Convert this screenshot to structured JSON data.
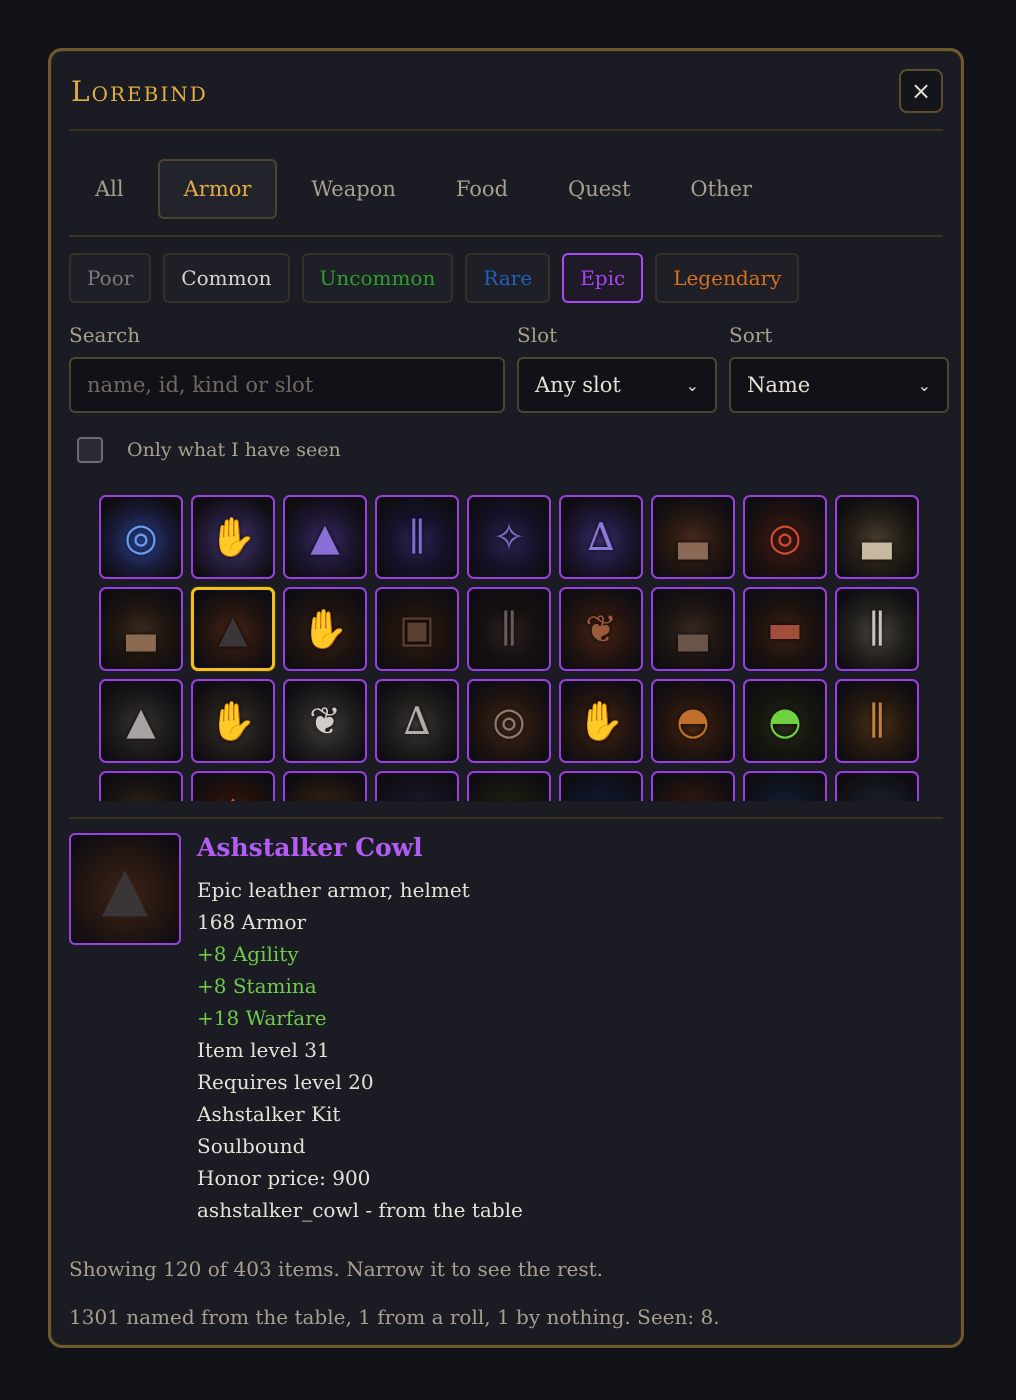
{
  "app": {
    "title": "Lorebind",
    "close_glyph": "×"
  },
  "tabs": [
    "All",
    "Armor",
    "Weapon",
    "Food",
    "Quest",
    "Other"
  ],
  "active_tab": "Armor",
  "rarities": [
    {
      "label": "Poor",
      "color": "#7b7b7b",
      "active": false
    },
    {
      "label": "Common",
      "color": "#d8d4cc",
      "active": false
    },
    {
      "label": "Uncommon",
      "color": "#2ca02c",
      "active": false
    },
    {
      "label": "Rare",
      "color": "#2060c0",
      "active": false
    },
    {
      "label": "Epic",
      "color": "#a845f0",
      "active": true
    },
    {
      "label": "Legendary",
      "color": "#d8701c",
      "active": false
    }
  ],
  "filters": {
    "search_label": "Search",
    "search_placeholder": "name, id, kind or slot",
    "slot_label": "Slot",
    "slot_value": "Any slot",
    "sort_label": "Sort",
    "sort_value": "Name",
    "seen_checkbox_label": "Only what I have seen",
    "seen_checked": false
  },
  "grid": {
    "selected_index": 10,
    "items": [
      {
        "icon": "ring-icon",
        "c1": "#2b4f9c",
        "c2": "#1a1c3d",
        "gc": "#6b9af2"
      },
      {
        "icon": "gauntlets-icon",
        "c1": "#4d3d7c",
        "c2": "#221c38",
        "gc": "#9d8ee0"
      },
      {
        "icon": "hood-icon",
        "c1": "#3a2c6a",
        "c2": "#1c1530",
        "gc": "#8a70d6"
      },
      {
        "icon": "leggings-icon",
        "c1": "#2a2556",
        "c2": "#14122a",
        "gc": "#7b6cd0"
      },
      {
        "icon": "wings-icon",
        "c1": "#2a2350",
        "c2": "#15122a",
        "gc": "#7d6cc8"
      },
      {
        "icon": "robe-icon",
        "c1": "#3b2f6e",
        "c2": "#1c1634",
        "gc": "#8b78d8"
      },
      {
        "icon": "boots-icon",
        "c1": "#4a2a1c",
        "c2": "#231611",
        "gc": "#8a6a56"
      },
      {
        "icon": "ring-icon",
        "c1": "#4a1f18",
        "c2": "#221210",
        "gc": "#d04a30"
      },
      {
        "icon": "boots-icon",
        "c1": "#4a3e30",
        "c2": "#231d16",
        "gc": "#c8b8a0"
      },
      {
        "icon": "boots-icon",
        "c1": "#3e2a1e",
        "c2": "#1d1510",
        "gc": "#8a6a50"
      },
      {
        "icon": "hood-icon",
        "c1": "#4a2616",
        "c2": "#231410",
        "gc": "#3a3638"
      },
      {
        "icon": "gauntlets-icon",
        "c1": "#3e2418",
        "c2": "#1e1410",
        "gc": "#9a8070"
      },
      {
        "icon": "chest-armor-icon",
        "c1": "#3a2216",
        "c2": "#1c120e",
        "gc": "#5a4030"
      },
      {
        "icon": "leggings-icon",
        "c1": "#2c2220",
        "c2": "#151010",
        "gc": "#6a5a58"
      },
      {
        "icon": "pauldrons-icon",
        "c1": "#4a2416",
        "c2": "#231410",
        "gc": "#9a5a3a"
      },
      {
        "icon": "boots-icon",
        "c1": "#3a2a22",
        "c2": "#1c1512",
        "gc": "#6a5448"
      },
      {
        "icon": "belt-icon",
        "c1": "#3e2216",
        "c2": "#1d120e",
        "gc": "#a0503a"
      },
      {
        "icon": "leggings-icon",
        "c1": "#4a4640",
        "c2": "#22201c",
        "gc": "#c8c4bc"
      },
      {
        "icon": "hood-icon",
        "c1": "#3a3636",
        "c2": "#1c1a1a",
        "gc": "#a8a2a0"
      },
      {
        "icon": "gauntlets-icon",
        "c1": "#403a34",
        "c2": "#1e1b18",
        "gc": "#c0b8ac"
      },
      {
        "icon": "pauldrons-icon",
        "c1": "#444040",
        "c2": "#201e1e",
        "gc": "#d0ccc6"
      },
      {
        "icon": "robe-icon",
        "c1": "#3c3a38",
        "c2": "#1d1c1a",
        "gc": "#b0aca6"
      },
      {
        "icon": "ring-icon",
        "c1": "#4a2a18",
        "c2": "#211510",
        "gc": "#8a7a70"
      },
      {
        "icon": "gauntlets-icon",
        "c1": "#4a2c1a",
        "c2": "#231510",
        "gc": "#b07a4a"
      },
      {
        "icon": "helmet-icon",
        "c1": "#4a2814",
        "c2": "#23140e",
        "gc": "#c0702a"
      },
      {
        "icon": "helmet-icon",
        "c1": "#2a2e1e",
        "c2": "#14160e",
        "gc": "#70d040"
      },
      {
        "icon": "leggings-icon",
        "c1": "#4a3018",
        "c2": "#231810",
        "gc": "#c08040"
      },
      {
        "icon": "belt-icon",
        "c1": "#3a2e24",
        "c2": "#1c1612",
        "gc": "#8a7a60"
      },
      {
        "icon": "gem-icon",
        "c1": "#4a1e10",
        "c2": "#22100a",
        "gc": "#e05020"
      },
      {
        "icon": "chest-armor-icon",
        "c1": "#4a3018",
        "c2": "#231810",
        "gc": "#d0902a"
      },
      {
        "icon": "chest-armor-icon",
        "c1": "#2c2640",
        "c2": "#151220",
        "gc": "#9a8cc0"
      },
      {
        "icon": "chest-armor-icon",
        "c1": "#2a3020",
        "c2": "#151810",
        "gc": "#a0a040"
      },
      {
        "icon": "chest-armor-icon",
        "c1": "#1a2a4a",
        "c2": "#0e1424",
        "gc": "#5a8ad0"
      },
      {
        "icon": "chest-armor-icon",
        "c1": "#4a2416",
        "c2": "#23120e",
        "gc": "#d06030"
      },
      {
        "icon": "ring-icon",
        "c1": "#1a2e4a",
        "c2": "#0e1624",
        "gc": "#6aa0e0"
      },
      {
        "icon": "chest-armor-icon",
        "c1": "#2a3040",
        "c2": "#141820",
        "gc": "#c0c8d8"
      }
    ]
  },
  "detail": {
    "name": "Ashstalker Cowl",
    "name_color": "#b35cf4",
    "icon": "hood-icon",
    "lines": [
      {
        "text": "Epic leather armor, helmet",
        "green": false
      },
      {
        "text": "168 Armor",
        "green": false
      },
      {
        "text": "+8 Agility",
        "green": true
      },
      {
        "text": "+8 Stamina",
        "green": true
      },
      {
        "text": "+18 Warfare",
        "green": true
      },
      {
        "text": "Item level 31",
        "green": false
      },
      {
        "text": "Requires level 20",
        "green": false
      },
      {
        "text": "Ashstalker Kit",
        "green": false
      },
      {
        "text": "Soulbound",
        "green": false
      },
      {
        "text": "Honor price: 900",
        "green": false
      },
      {
        "text": "ashstalker_cowl - from the table",
        "green": false
      }
    ]
  },
  "footer": {
    "showing": "Showing 120 of 403 items. Narrow it to see the rest.",
    "stats": "1301 named from the table, 1 from a roll, 1 by nothing. Seen: 8."
  }
}
